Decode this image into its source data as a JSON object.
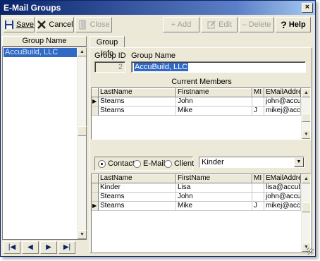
{
  "window": {
    "title": "E-Mail Groups"
  },
  "toolbar": {
    "save": "Save",
    "cancel": "Cancel",
    "close": "Close",
    "add": "+ Add",
    "edit": "Edit",
    "delete": "Delete",
    "help": "Help"
  },
  "left_list": {
    "header": "Group Name",
    "items": [
      "AccuBuild, LLC"
    ]
  },
  "tab": {
    "label": "Group Info"
  },
  "group_info": {
    "group_id_label": "Group ID",
    "group_id_value": "2",
    "group_name_label": "Group Name",
    "group_name_value": "AccuBuild, LLC"
  },
  "current_members": {
    "title": "Current Members",
    "columns": [
      "LastName",
      "Firstname",
      "MI",
      "EMailAddress"
    ],
    "rows": [
      {
        "last": "Stearns",
        "first": "John",
        "mi": "",
        "email": "john@accubu"
      },
      {
        "last": "Stearns",
        "first": "Mike",
        "mi": "J",
        "email": "mikej@accub"
      }
    ]
  },
  "filter": {
    "options": [
      "Contact",
      "E-Mail",
      "Client"
    ],
    "selected": "Contact",
    "combo_value": "Kinder"
  },
  "available": {
    "columns": [
      "LastName",
      "FirstName",
      "MI",
      "EMailAddress"
    ],
    "rows": [
      {
        "last": "Kinder",
        "first": "Lisa",
        "mi": "",
        "email": "lisa@accubu"
      },
      {
        "last": "Stearns",
        "first": "John",
        "mi": "",
        "email": "john@accubu"
      },
      {
        "last": "Stearns",
        "first": "Mike",
        "mi": "J",
        "email": "mikej@accub"
      }
    ]
  }
}
